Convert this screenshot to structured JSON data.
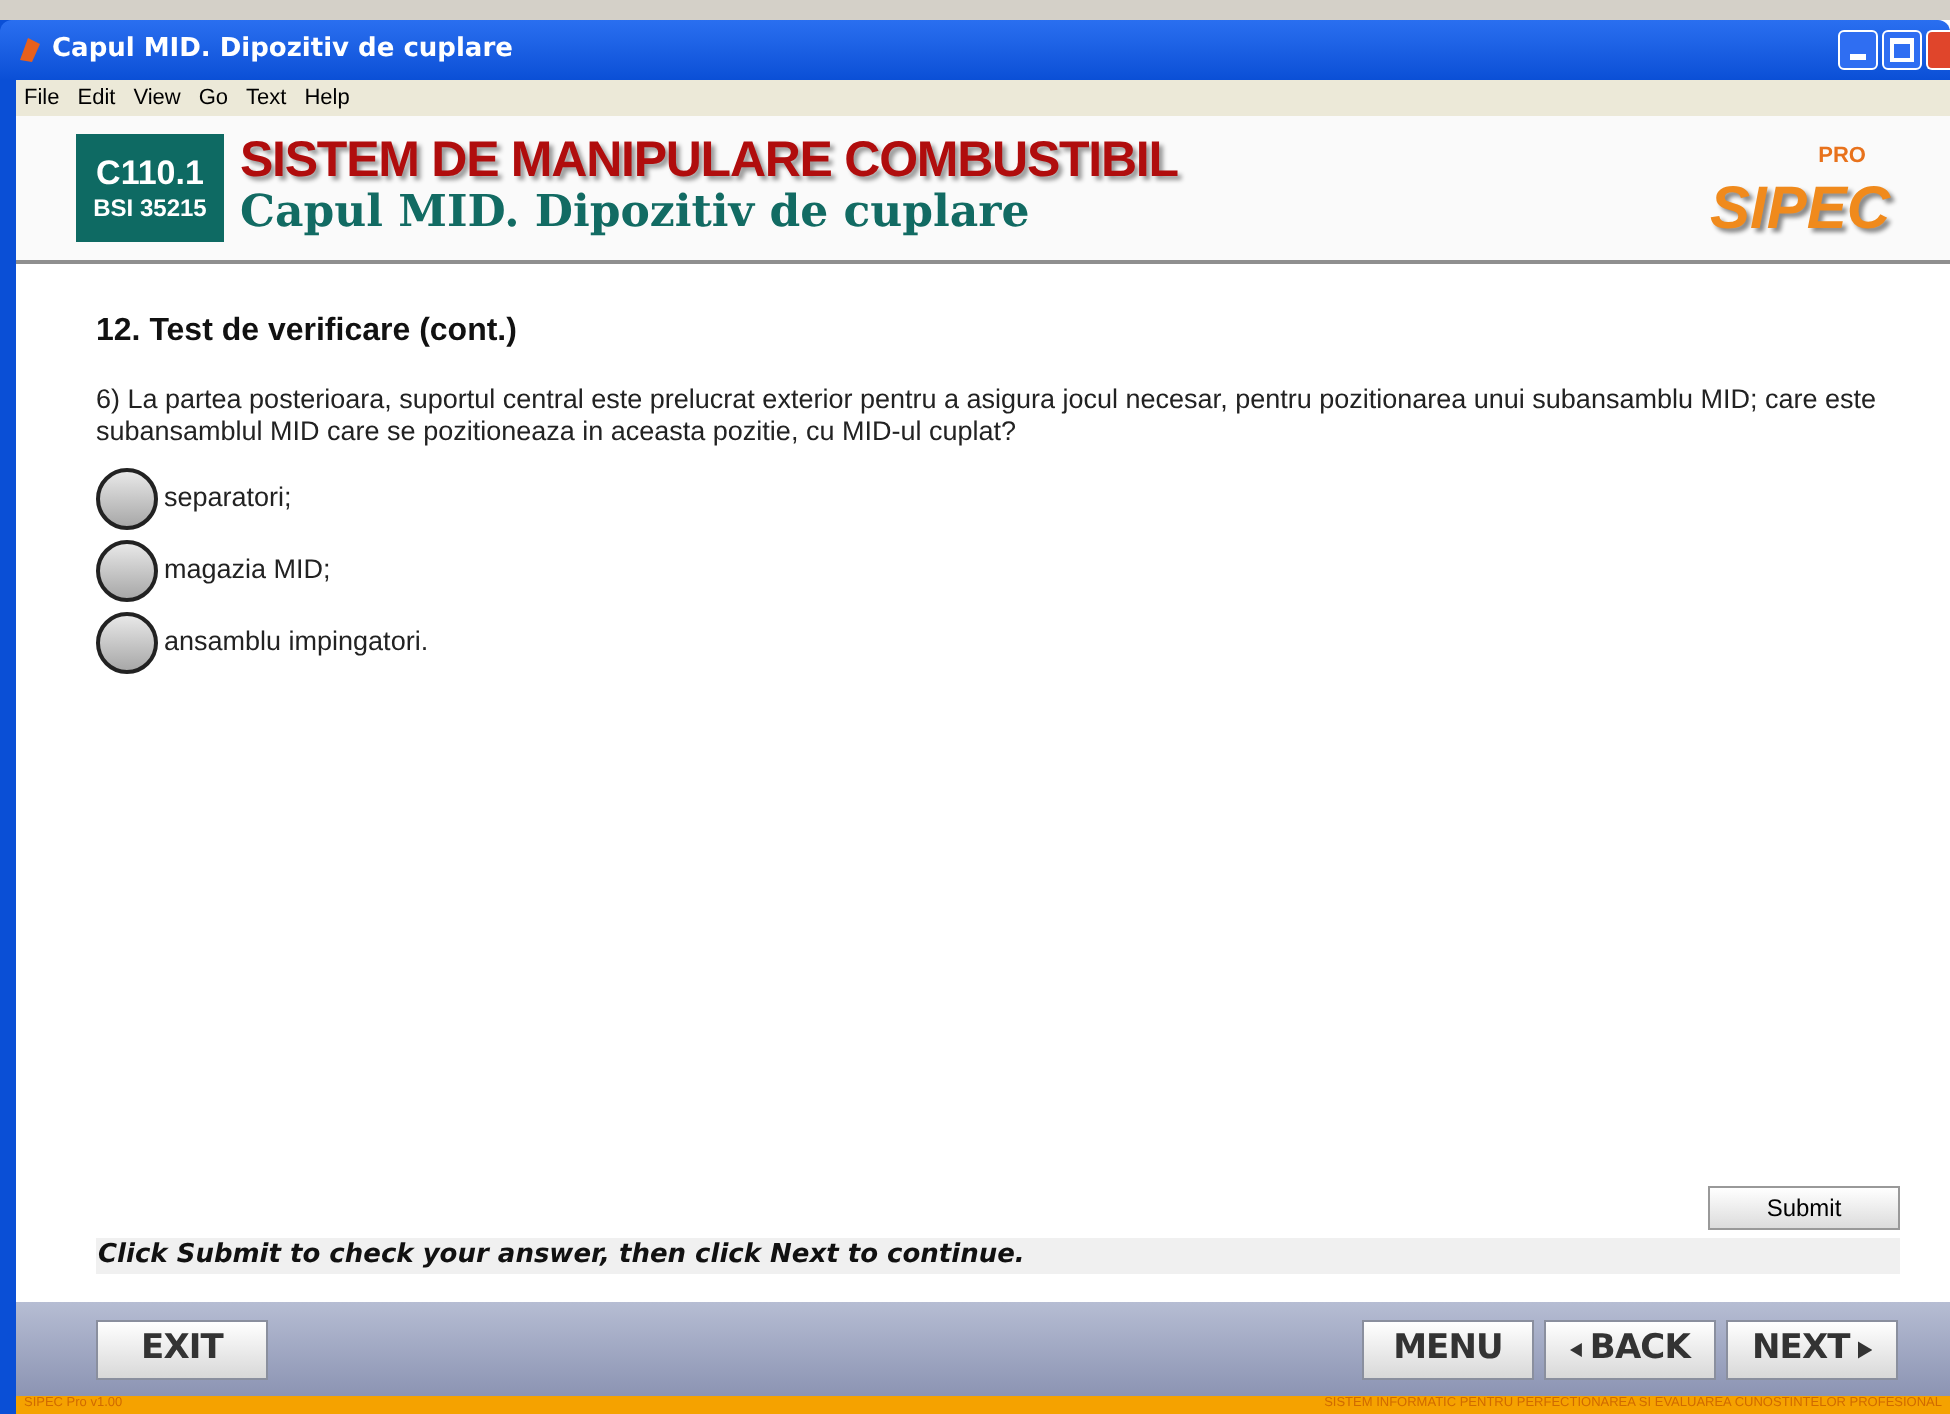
{
  "window": {
    "title": "Capul MID. Dipozitiv de cuplare"
  },
  "menu": [
    "File",
    "Edit",
    "View",
    "Go",
    "Text",
    "Help"
  ],
  "header": {
    "code": "C110.1",
    "standard": "BSI 35215",
    "title": "SISTEM DE MANIPULARE COMBUSTIBIL",
    "subtitle": "Capul MID. Dipozitiv de cuplare",
    "logo": {
      "badge": "PRO",
      "name": "SIPEC"
    }
  },
  "section_title": "12. Test de verificare (cont.)",
  "question": "6) La partea posterioara, suportul central este prelucrat exterior pentru a asigura jocul necesar, pentru pozitionarea unui subansamblu MID; care este subansamblul MID care se pozitioneaza in aceasta pozitie, cu MID-ul cuplat?",
  "options": [
    {
      "label": "separatori;",
      "selected": false
    },
    {
      "label": "magazia MID;",
      "selected": false
    },
    {
      "label": "ansamblu impingatori.",
      "selected": false
    }
  ],
  "submit": "Submit",
  "instruction": "Click Submit to check your answer, then click Next to continue.",
  "nav": {
    "exit": "EXIT",
    "menu": "MENU",
    "back": "BACK",
    "next": "NEXT"
  },
  "status_bar": {
    "version": "SIPEC Pro v1.00",
    "system": "SISTEM INFORMATIC PENTRU PERFECTIONAREA SI EVALUAREA CUNOSTINTELOR PROFESIONAL"
  }
}
